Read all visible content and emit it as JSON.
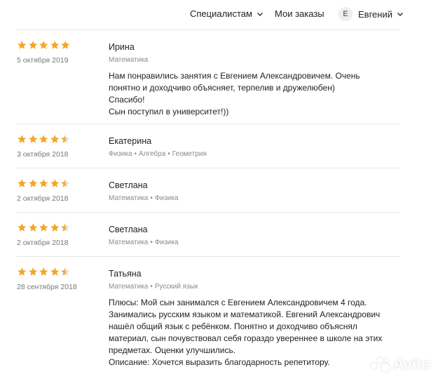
{
  "header": {
    "specialists_label": "Специалистам",
    "orders_label": "Мои заказы",
    "user_initial": "Е",
    "user_name": "Евгений"
  },
  "colors": {
    "star": "#f5a623",
    "star_empty": "#dcdcdc"
  },
  "reviews": [
    {
      "rating": 5,
      "date": "5 октября 2019",
      "name": "Ирина",
      "subjects": [
        "Математика"
      ],
      "text": "Нам понравились занятия с Евгением Александровичем. Очень\nпонятно и доходчиво объясняет, терпелив и дружелюбен)\nСпасибо!\nСын поступил в университет!))"
    },
    {
      "rating": 4.5,
      "date": "3 октября 2018",
      "name": "Екатерина",
      "subjects": [
        "Физика",
        "Алгебра",
        "Геометрия"
      ],
      "text": ""
    },
    {
      "rating": 4.5,
      "date": "2 октября 2018",
      "name": "Светлана",
      "subjects": [
        "Математика",
        "Физика"
      ],
      "text": ""
    },
    {
      "rating": 4.5,
      "date": "2 октября 2018",
      "name": "Светлана",
      "subjects": [
        "Математика",
        "Физика"
      ],
      "text": ""
    },
    {
      "rating": 4.5,
      "date": "28 сентября 2018",
      "name": "Татьяна",
      "subjects": [
        "Математика",
        "Русский язык"
      ],
      "text": "Плюсы: Мой сын занимался с Евгением Александровичем 4 года.\nЗанимались русским языком и математикой. Евгений Александрович\nнашёл общий язык с ребёнком. Понятно и доходчиво объяснял\nматериал, сын почувствовал себя гораздо увереннее в школе на этих\nпредметах. Оценки улучшились.\nОписание: Хочется выразить благодарность репетитору."
    }
  ],
  "watermark": {
    "text": "Avito"
  }
}
